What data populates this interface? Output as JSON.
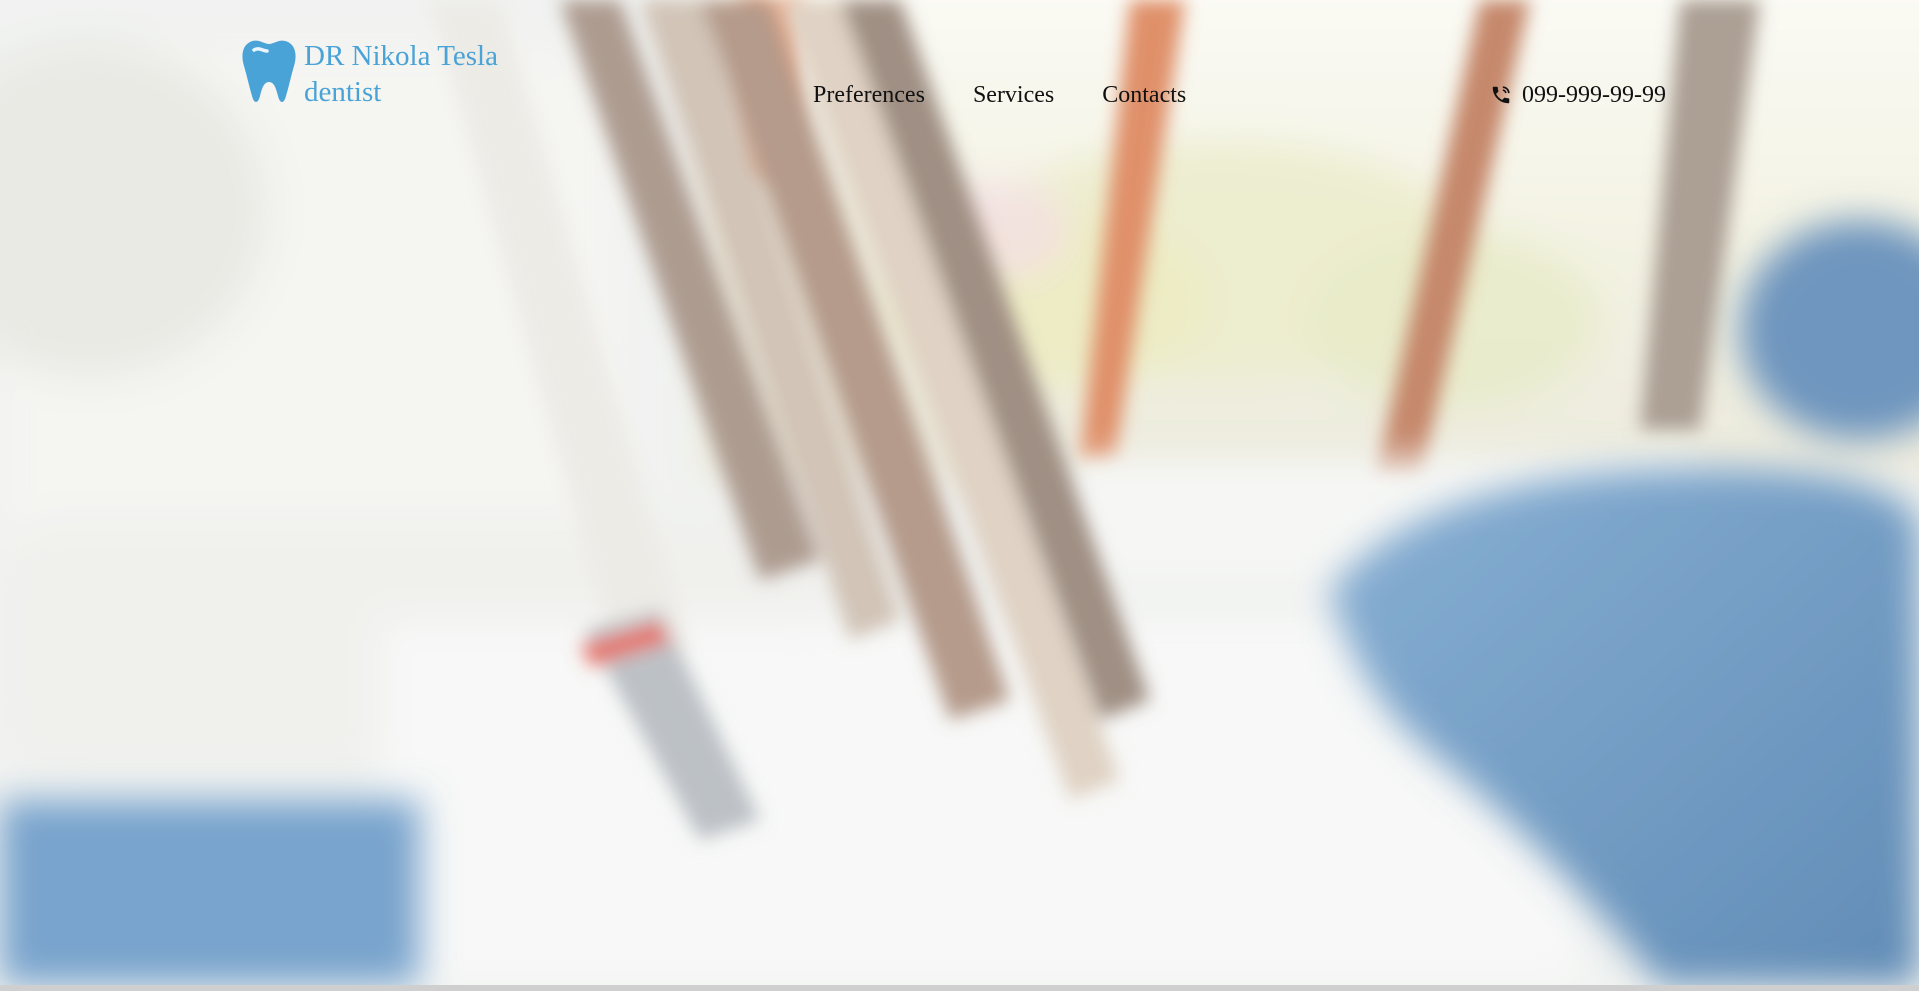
{
  "brand": {
    "name_line1": "DR Nikola Tesla",
    "name_line2": "dentist",
    "color": "#4aa3d6"
  },
  "nav": {
    "items": [
      {
        "label": "Preferences"
      },
      {
        "label": "Services"
      },
      {
        "label": "Contacts"
      }
    ]
  },
  "contact": {
    "phone": "099-999-99-99",
    "icon": "phone-icon"
  },
  "hero": {
    "background": "blurred dental office with dental drills and blue chair",
    "accent_blue": "#4f86b8"
  }
}
